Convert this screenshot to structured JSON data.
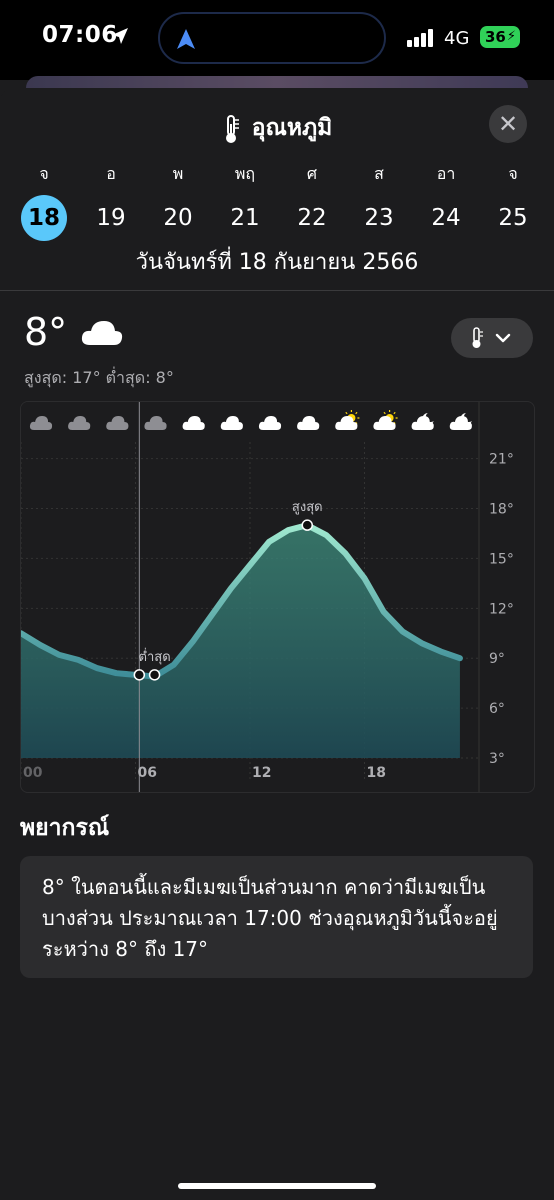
{
  "status_bar": {
    "time": "07:06",
    "network": "4G",
    "battery": "36"
  },
  "sheet": {
    "title": "อุณหภูมิ",
    "close_label": "✕",
    "days": [
      {
        "dow": "จ",
        "num": "18",
        "selected": true
      },
      {
        "dow": "อ",
        "num": "19"
      },
      {
        "dow": "พ",
        "num": "20"
      },
      {
        "dow": "พฤ",
        "num": "21"
      },
      {
        "dow": "ศ",
        "num": "22"
      },
      {
        "dow": "ส",
        "num": "23"
      },
      {
        "dow": "อา",
        "num": "24"
      },
      {
        "dow": "จ",
        "num": "25"
      }
    ],
    "date_line": "วันจันทร์ที่ 18 กันยายน 2566"
  },
  "current": {
    "temp": "8°",
    "hi_lo": "สูงสุด: 17° ต่ำสุด: 8°"
  },
  "chart_data": {
    "type": "area",
    "x": [
      0,
      1,
      2,
      3,
      4,
      5,
      6,
      7,
      8,
      9,
      10,
      11,
      12,
      13,
      14,
      15,
      16,
      17,
      18,
      19,
      20,
      21,
      22,
      23
    ],
    "values": [
      10.5,
      9.8,
      9.2,
      8.9,
      8.4,
      8.1,
      8.0,
      7.9,
      8.6,
      10.0,
      11.6,
      13.2,
      14.6,
      16.0,
      16.7,
      17.0,
      16.4,
      15.3,
      13.8,
      11.8,
      10.6,
      9.9,
      9.4,
      9.0
    ],
    "ylim": [
      3,
      22
    ],
    "y_ticks": [
      "21°",
      "18°",
      "15°",
      "12°",
      "9°",
      "6°",
      "3°"
    ],
    "x_ticks": [
      "00",
      "06",
      "12",
      "18"
    ],
    "annotations": [
      {
        "label": "สูงสุด",
        "x": 15,
        "value": 17
      },
      {
        "label": "ต่ำสุด",
        "x": 7,
        "value": 8
      }
    ],
    "hourly_icons": [
      "cloud",
      "cloud",
      "cloud",
      "cloud",
      "cloud",
      "cloud",
      "cloud",
      "cloud",
      "sun-cloud",
      "sun-cloud",
      "moon-cloud",
      "moon-cloud"
    ],
    "grid": true,
    "colors": {
      "line_low": "#3f8e99",
      "line_high": "#9fe8cf",
      "area": "#1e4a55"
    }
  },
  "forecast": {
    "title": "พยากรณ์",
    "text": "8° ในตอนนี้และมีเมฆเป็นส่วนมาก คาดว่ามีเมฆเป็นบางส่วน ประมาณเวลา 17:00 ช่วงอุณหภูมิวันนี้จะอยู่ระหว่าง 8° ถึง 17°"
  },
  "colors": {
    "accent": "#5ac8fa",
    "background": "#1c1c1e",
    "card": "#2c2c2e"
  }
}
